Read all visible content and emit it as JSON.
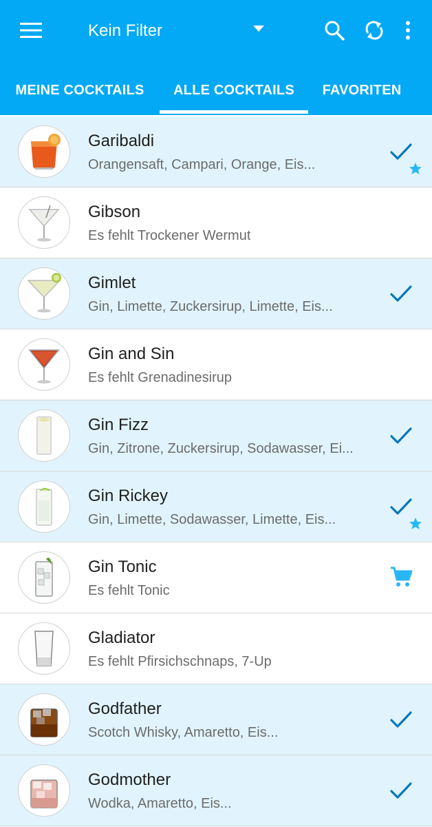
{
  "toolbar": {
    "menu_icon": "hamburger-menu-icon",
    "filter_label": "Kein Filter",
    "filter_dropdown_icon": "dropdown-arrow-icon",
    "search_icon": "search-icon",
    "sync_icon": "sync-icon",
    "more_icon": "more-vert-icon"
  },
  "tabs": [
    {
      "label": "MEINE COCKTAILS",
      "selected": false
    },
    {
      "label": "ALLE COCKTAILS",
      "selected": true
    },
    {
      "label": "FAVORITEN",
      "selected": false
    }
  ],
  "colors": {
    "primary": "#03a9f4",
    "row_available": "#e1f4fd",
    "check": "#0277bd",
    "star": "#29b6f6",
    "cart": "#29b6f6"
  },
  "cocktails": [
    {
      "name": "Garibaldi",
      "subtitle": "Orangensaft, Campari, Orange, Eis...",
      "available": true,
      "status_icon": "check-icon",
      "favorite": true,
      "image": "garibaldi-glass"
    },
    {
      "name": "Gibson",
      "subtitle": "Es fehlt Trockener Wermut",
      "available": false,
      "status_icon": "",
      "favorite": false,
      "image": "gibson-glass"
    },
    {
      "name": "Gimlet",
      "subtitle": "Gin, Limette, Zuckersirup, Limette, Eis...",
      "available": true,
      "status_icon": "check-icon",
      "favorite": false,
      "image": "gimlet-glass"
    },
    {
      "name": "Gin and Sin",
      "subtitle": "Es fehlt Grenadinesirup",
      "available": false,
      "status_icon": "",
      "favorite": false,
      "image": "gin-and-sin-glass"
    },
    {
      "name": "Gin Fizz",
      "subtitle": "Gin, Zitrone, Zuckersirup, Sodawasser, Ei...",
      "available": true,
      "status_icon": "check-icon",
      "favorite": false,
      "image": "gin-fizz-glass"
    },
    {
      "name": "Gin Rickey",
      "subtitle": "Gin, Limette, Sodawasser, Limette, Eis...",
      "available": true,
      "status_icon": "check-icon",
      "favorite": true,
      "image": "gin-rickey-glass"
    },
    {
      "name": "Gin Tonic",
      "subtitle": "Es fehlt Tonic",
      "available": false,
      "status_icon": "cart-icon",
      "favorite": false,
      "image": "gin-tonic-glass"
    },
    {
      "name": "Gladiator",
      "subtitle": "Es fehlt Pfirsichschnaps, 7-Up",
      "available": false,
      "status_icon": "",
      "favorite": false,
      "image": "gladiator-glass"
    },
    {
      "name": "Godfather",
      "subtitle": "Scotch Whisky, Amaretto, Eis...",
      "available": true,
      "status_icon": "check-icon",
      "favorite": false,
      "image": "godfather-glass"
    },
    {
      "name": "Godmother",
      "subtitle": "Wodka, Amaretto, Eis...",
      "available": true,
      "status_icon": "check-icon",
      "favorite": false,
      "image": "godmother-glass"
    }
  ]
}
